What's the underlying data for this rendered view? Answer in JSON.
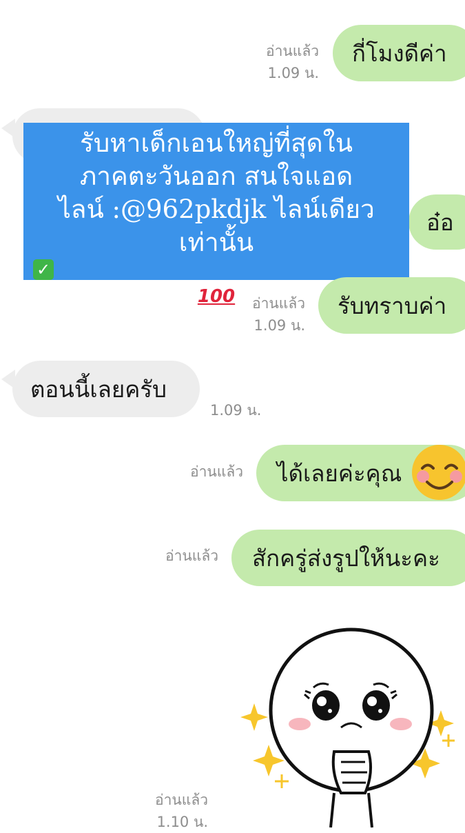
{
  "messages": [
    {
      "text": "กี่โมงดีค่า",
      "read": "อ่านแล้ว",
      "time": "1.09 น."
    },
    {
      "text": "อ๋อ"
    },
    {
      "text": "รับทราบค่า",
      "read": "อ่านแล้ว",
      "time": "1.09 น."
    },
    {
      "text": "ตอนนี้เลยครับ",
      "time": "1.09 น."
    },
    {
      "text": "ได้เลยค่ะคุณ",
      "read": "อ่านแล้ว",
      "emoji": "smiling-face-emoji"
    },
    {
      "text": "สักครู่ส่งรูปให้นะคะ",
      "read": "อ่านแล้ว"
    },
    {
      "sticker": "moon-pleading-sticker",
      "read": "อ่านแล้ว",
      "time": "1.10 น."
    }
  ],
  "overlay": {
    "lines": [
      "รับหาเด็กเอนใหญ่ที่สุดใน",
      "ภาคตะวันออก สนใจแอด",
      "ไลน์ :@962pkdjk ไลน์เดียว",
      "เท่านั้น"
    ],
    "check_icon": "check-mark-icon",
    "hundred_icon": "hundred-points-icon",
    "check_glyph": "✓",
    "hundred_glyph": "100"
  },
  "colors": {
    "my_bubble": "#c4eaac",
    "their_bubble": "#ededed",
    "overlay": "#3b93ea",
    "meta_text": "#8d8d8d"
  }
}
